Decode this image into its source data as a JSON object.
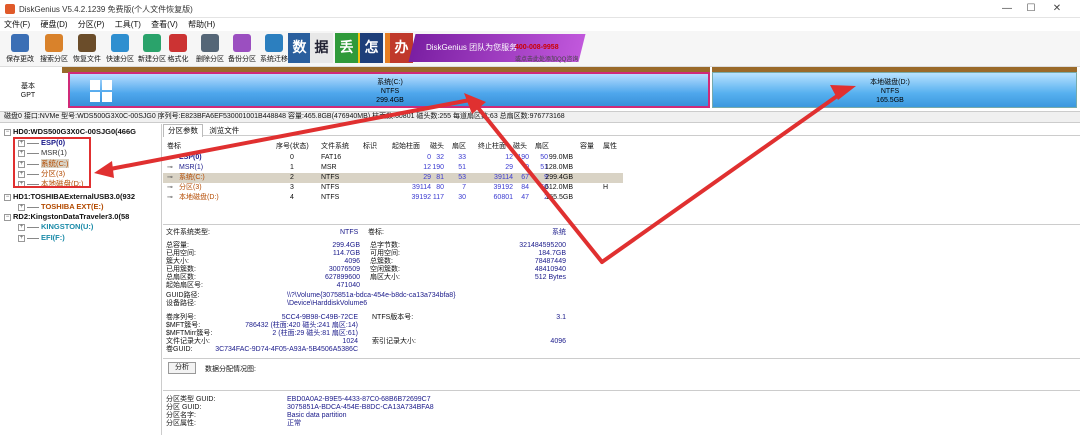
{
  "titlebar": {
    "title": "DiskGenius V5.4.2.1239 免费版(个人文件恢复版)"
  },
  "menu": [
    "文件(F)",
    "硬盘(D)",
    "分区(P)",
    "工具(T)",
    "查看(V)",
    "帮助(H)"
  ],
  "toolbar": [
    {
      "label": "保存更改",
      "color": "#3b6fb5"
    },
    {
      "label": "搜索分区",
      "color": "#d9822b"
    },
    {
      "label": "恢复文件",
      "color": "#6b4d2a"
    },
    {
      "label": "快速分区",
      "color": "#2f8fd0"
    },
    {
      "label": "新建分区",
      "color": "#2aa36b"
    },
    {
      "label": "格式化",
      "color": "#cc3333"
    },
    {
      "label": "删除分区",
      "color": "#556677"
    },
    {
      "label": "备份分区",
      "color": "#9b4fc0"
    },
    {
      "label": "系统迁移",
      "color": "#2c7fbf"
    }
  ],
  "ads": {
    "chars": [
      "数",
      "据",
      "丢",
      "失",
      "怎",
      "么",
      "办"
    ],
    "banner": "DiskGenius 团队为您服务",
    "phone": "400-008-9958",
    "note": "或点击此处添加QQ咨询"
  },
  "disk_label": {
    "line1": "基本",
    "line2": "GPT"
  },
  "partitions_bar": {
    "system": {
      "name": "系统(C:)",
      "fs": "NTFS",
      "size": "299.4GB"
    },
    "local": {
      "name": "本地磁盘(D:)",
      "fs": "NTFS",
      "size": "165.5GB"
    }
  },
  "infobar": "磁盘0 接口:NVMe  型号:WDS500G3X0C-00SJG0  序列号:E823BFA6EF530001001B448848  容量:465.8GB(476940MB)  柱面数:60801  磁头数:255  每道扇区数:63  总扇区数:976773168",
  "tree": [
    {
      "text": "HD0:WDS500G3X0C-00SJG0(466G",
      "color": "#000",
      "bold": true
    },
    {
      "text": "ESP(0)",
      "color": "#1a1a8a",
      "bold": true
    },
    {
      "text": "MSR(1)",
      "color": "#333",
      "bold": false
    },
    {
      "text": "系统(C:)",
      "color": "#b34a00",
      "bold": false
    },
    {
      "text": "分区(3)",
      "color": "#b34a00",
      "bold": false
    },
    {
      "text": "本地磁盘(D:)",
      "color": "#b34a00",
      "bold": false
    },
    {
      "text": "HD1:TOSHIBAExternalUSB3.0(932",
      "color": "#000",
      "bold": true
    },
    {
      "text": "TOSHIBA EXT(E:)",
      "color": "#b34a00",
      "bold": true
    },
    {
      "text": "RD2:KingstonDataTraveler3.0(58",
      "color": "#000",
      "bold": true
    },
    {
      "text": "KINGSTON(U:)",
      "color": "#1a8aa8",
      "bold": true
    },
    {
      "text": "EFI(F:)",
      "color": "#1a8aa8",
      "bold": true
    }
  ],
  "tabs": [
    "分区参数",
    "浏览文件"
  ],
  "table": {
    "headers": [
      "卷标",
      "序号(状态)",
      "文件系统",
      "标识",
      "起始柱面",
      "磁头",
      "扇区",
      "终止柱面",
      "磁头",
      "扇区",
      "容量",
      "属性"
    ],
    "rows": [
      [
        "ESP(0)",
        "0",
        "FAT16",
        "",
        "0",
        "32",
        "33",
        "12",
        "190",
        "50",
        "99.0MB",
        ""
      ],
      [
        "MSR(1)",
        "1",
        "MSR",
        "",
        "12",
        "190",
        "51",
        "29",
        "0",
        "51",
        "128.0MB",
        ""
      ],
      [
        "系统(C:)",
        "2",
        "NTFS",
        "",
        "29",
        "81",
        "53",
        "39114",
        "67",
        "9",
        "299.4GB",
        ""
      ],
      [
        "分区(3)",
        "3",
        "NTFS",
        "",
        "39114",
        "80",
        "7",
        "39192",
        "84",
        "60",
        "612.0MB",
        "H"
      ],
      [
        "本地磁盘(D:)",
        "4",
        "NTFS",
        "",
        "39192",
        "117",
        "30",
        "60801",
        "47",
        "2",
        "165.5GB",
        ""
      ]
    ]
  },
  "fs_header": {
    "label": "文件系统类型:",
    "value": "NTFS",
    "vol_label": "卷标:",
    "vol_value": "系统"
  },
  "details_left": [
    [
      "总容量:",
      "299.4GB"
    ],
    [
      "已用空间:",
      "114.7GB"
    ],
    [
      "簇大小:",
      "4096"
    ],
    [
      "已用簇数:",
      "30076509"
    ],
    [
      "总扇区数:",
      "627899600"
    ],
    [
      "起始扇区号:",
      "471040"
    ]
  ],
  "details_right": [
    [
      "总字节数:",
      "321484595200"
    ],
    [
      "可用空间:",
      "184.7GB"
    ],
    [
      "总簇数:",
      "78487449"
    ],
    [
      "空闲簇数:",
      "48410940"
    ],
    [
      "扇区大小:",
      "512 Bytes"
    ]
  ],
  "guid": {
    "label": "GUID路径:",
    "value": "\\\\?\\Volume{3075851a-bdca-454e-b8dc-ca13a734bfa8}"
  },
  "device": {
    "label": "设备路径:",
    "value": "\\Device\\HarddiskVolume6"
  },
  "ntfs": [
    [
      "卷序列号:",
      "5CC4-9B98-C49B-72CE",
      "NTFS版本号:",
      "3.1"
    ],
    [
      "$MFT簇号:",
      "786432 (柱面:420 磁头:241 扇区:14)",
      "",
      ""
    ],
    [
      "$MFTMirr簇号:",
      "2 (柱面:29 磁头:81 扇区:61)",
      "",
      ""
    ],
    [
      "文件记录大小:",
      "1024",
      "索引记录大小:",
      "4096"
    ],
    [
      "卷GUID:",
      "3C734FAC-9D74-4F05-A93A-5B4506A5386C",
      "",
      ""
    ]
  ],
  "analyze": {
    "button": "分析",
    "label": "数据分配情况图:"
  },
  "partition_info": [
    [
      "分区类型 GUID:",
      "EBD0A0A2-B9E5-4433-87C0-68B6B72699C7"
    ],
    [
      "分区 GUID:",
      "3075851A-BDCA-454E-B8DC-CA13A734BFA8"
    ],
    [
      "分区名字:",
      "Basic data partition"
    ],
    [
      "分区属性:",
      "正常"
    ]
  ],
  "colors": {
    "accent_red": "#e03030",
    "system_border": "#d02a78",
    "partition_blue": "#4fa7ec",
    "strip_brown": "#9a6a2a"
  }
}
